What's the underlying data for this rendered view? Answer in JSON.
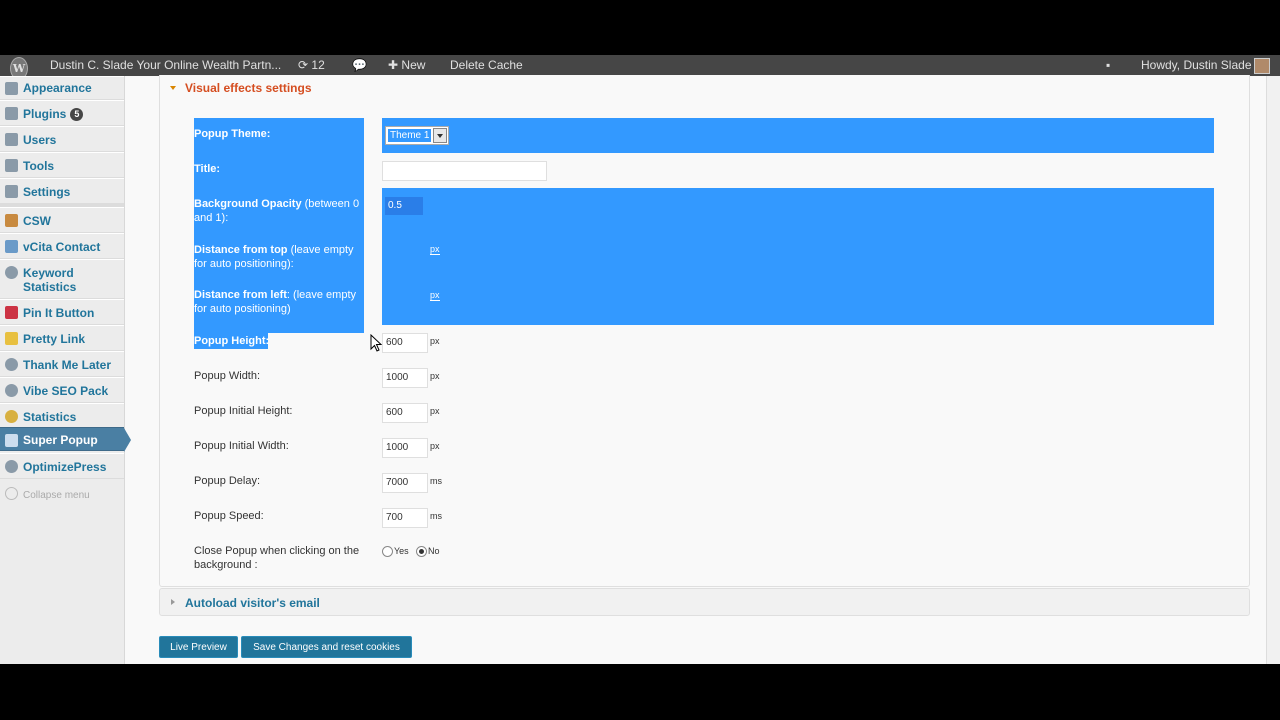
{
  "adminbar": {
    "site_name": "Dustin C. Slade Your Online Wealth Partn...",
    "updates_count": "12",
    "new_label": "New",
    "delete_cache": "Delete Cache",
    "howdy": "Howdy, Dustin Slade"
  },
  "sidebar": {
    "items": [
      {
        "label": "Appearance",
        "icon": "appearance-icon"
      },
      {
        "label": "Plugins",
        "badge": "5",
        "icon": "plugins-icon"
      },
      {
        "label": "Users",
        "icon": "users-icon"
      },
      {
        "label": "Tools",
        "icon": "tools-icon"
      },
      {
        "label": "Settings",
        "icon": "settings-icon"
      },
      {
        "label": "CSW",
        "icon": "csw-icon"
      },
      {
        "label": "vCita Contact",
        "icon": "vcita-icon"
      },
      {
        "label": "Keyword Statistics",
        "icon": "gear-icon"
      },
      {
        "label": "Pin It Button",
        "icon": "pinterest-icon"
      },
      {
        "label": "Pretty Link",
        "icon": "star-icon"
      },
      {
        "label": "Thank Me Later",
        "icon": "gear-icon"
      },
      {
        "label": "Vibe SEO Pack",
        "icon": "gear-icon"
      },
      {
        "label": "Statistics",
        "icon": "statistics-icon"
      },
      {
        "label": "Super Popup",
        "icon": "popup-icon",
        "active": true
      },
      {
        "label": "OptimizePress",
        "icon": "gear-icon"
      }
    ],
    "collapse": "Collapse menu"
  },
  "section": {
    "title": "Visual effects settings",
    "popup_theme_label": "Popup Theme:",
    "popup_theme_value": "Theme 1",
    "title_label": "Title:",
    "bg_opacity_label_bold": "Background Opacity",
    "bg_opacity_label_rest": " (between 0 and 1):",
    "bg_opacity_value": "0.5",
    "dist_top_label_bold": "Distance from top",
    "dist_top_label_rest": " (leave empty for auto positioning):",
    "dist_left_label_bold": "Distance from left",
    "dist_left_label_rest": ": (leave empty for auto positioning)",
    "popup_height_label": "Popup Height:",
    "popup_height_value": "600",
    "popup_width_label": "Popup Width:",
    "popup_width_value": "1000",
    "initial_height_label": "Popup Initial Height:",
    "initial_height_value": "600",
    "initial_width_label": "Popup Initial Width:",
    "initial_width_value": "1000",
    "delay_label": "Popup Delay:",
    "delay_value": "7000",
    "speed_label": "Popup Speed:",
    "speed_value": "700",
    "close_label": "Close Popup when clicking on the background :",
    "yes": "Yes",
    "no": "No",
    "unit_px": "px",
    "unit_ms": "ms"
  },
  "section2_title": "Autoload visitor's email",
  "buttons": {
    "live_preview": "Live Preview",
    "save": "Save Changes and reset cookies"
  },
  "colors": {
    "selection": "#3399ff",
    "accent": "#21759b",
    "section_title": "#d54e21"
  }
}
